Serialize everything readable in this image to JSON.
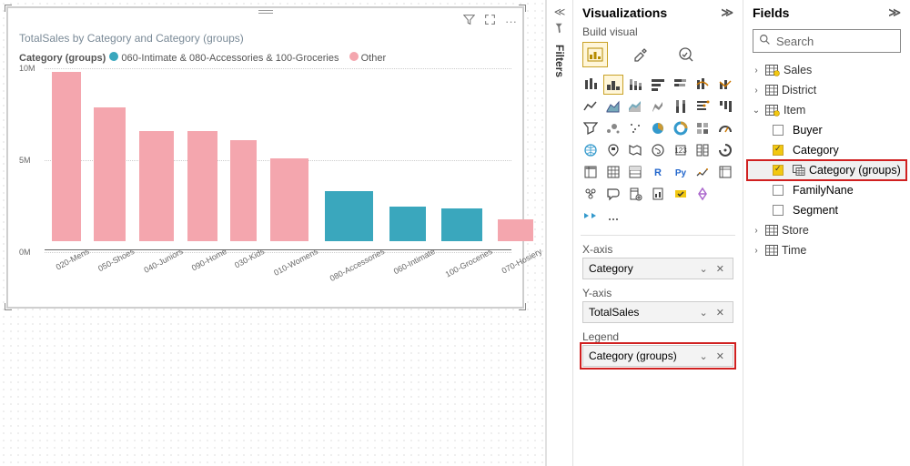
{
  "chart_data": {
    "type": "bar",
    "title": "TotalSales by Category and Category (groups)",
    "legend_title": "Category (groups)",
    "ylim": [
      0,
      10000000
    ],
    "yticks": [
      {
        "v": 0,
        "label": "0M"
      },
      {
        "v": 5000000,
        "label": "5M"
      },
      {
        "v": 10000000,
        "label": "10M"
      }
    ],
    "series_colors": {
      "Other": "#f4a6ae",
      "060-Intimate & 080-Accessories & 100-Groceries": "#3aa7bd"
    },
    "legend_items": [
      {
        "label": "060-Intimate & 080-Accessories & 100-Groceries",
        "color": "#3aa7bd"
      },
      {
        "label": "Other",
        "color": "#f4a6ae"
      }
    ],
    "bars": [
      {
        "cat": "020-Mens",
        "v": 9200000,
        "group": "Other"
      },
      {
        "cat": "050-Shoes",
        "v": 7300000,
        "group": "Other"
      },
      {
        "cat": "040-Juniors",
        "v": 6000000,
        "group": "Other"
      },
      {
        "cat": "090-Home",
        "v": 6000000,
        "group": "Other"
      },
      {
        "cat": "030-Kids",
        "v": 5500000,
        "group": "Other"
      },
      {
        "cat": "010-Womens",
        "v": 4500000,
        "group": "Other"
      },
      {
        "cat": "080-Accessories",
        "v": 2700000,
        "group": "060-Intimate & 080-Accessories & 100-Groceries"
      },
      {
        "cat": "060-Intimate",
        "v": 1900000,
        "group": "060-Intimate & 080-Accessories & 100-Groceries"
      },
      {
        "cat": "100-Groceries",
        "v": 1800000,
        "group": "060-Intimate & 080-Accessories & 100-Groceries"
      },
      {
        "cat": "070-Hosiery",
        "v": 1200000,
        "group": "Other"
      }
    ]
  },
  "filters_label": "Filters",
  "viz": {
    "title": "Visualizations",
    "subtitle": "Build visual",
    "wells": {
      "x_label": "X-axis",
      "x_value": "Category",
      "y_label": "Y-axis",
      "y_value": "TotalSales",
      "legend_label": "Legend",
      "legend_value": "Category (groups)"
    }
  },
  "fields": {
    "title": "Fields",
    "search_placeholder": "Search",
    "tables": [
      {
        "name": "Sales",
        "expanded": false,
        "badge": true
      },
      {
        "name": "District",
        "expanded": false,
        "badge": false
      },
      {
        "name": "Item",
        "expanded": true,
        "badge": true,
        "children": [
          {
            "name": "Buyer",
            "checked": false
          },
          {
            "name": "Category",
            "checked": true
          },
          {
            "name": "Category (groups)",
            "checked": true,
            "highlight": true,
            "groupicon": true
          },
          {
            "name": "FamilyNane",
            "checked": false
          },
          {
            "name": "Segment",
            "checked": false
          }
        ]
      },
      {
        "name": "Store",
        "expanded": false,
        "badge": false
      },
      {
        "name": "Time",
        "expanded": false,
        "badge": false
      }
    ]
  }
}
